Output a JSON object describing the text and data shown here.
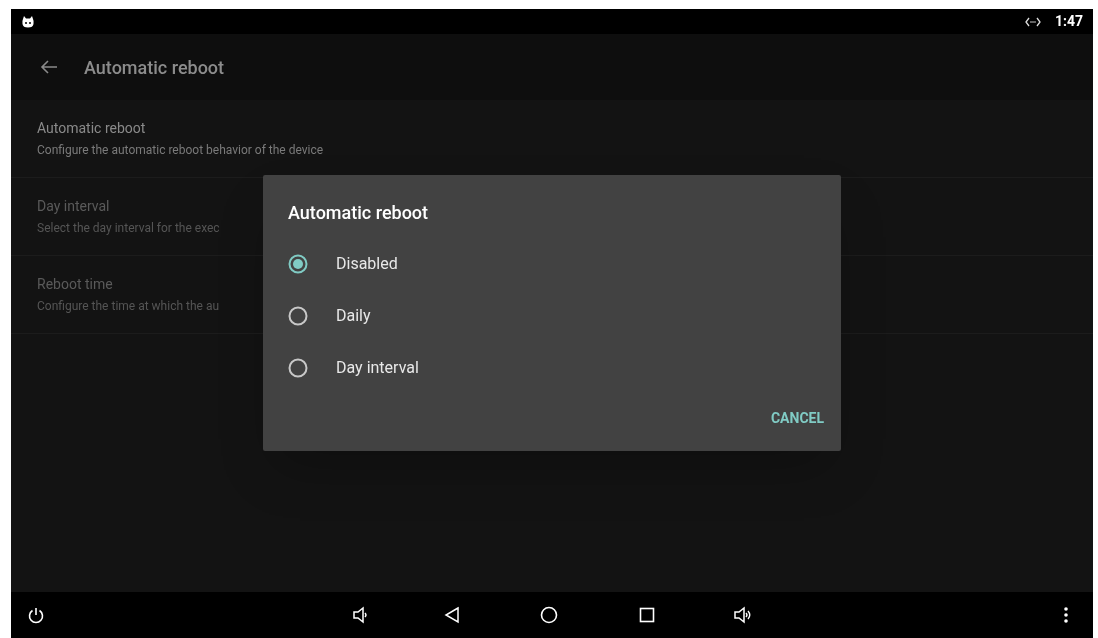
{
  "status_bar": {
    "time": "1:47"
  },
  "toolbar": {
    "title": "Automatic reboot"
  },
  "preferences": [
    {
      "title": "Automatic reboot",
      "summary": "Configure the automatic reboot behavior of the device",
      "enabled": true
    },
    {
      "title": "Day interval",
      "summary": "Select the day interval for the exec",
      "enabled": false
    },
    {
      "title": "Reboot time",
      "summary": "Configure the time at which the au",
      "enabled": false
    }
  ],
  "dialog": {
    "title": "Automatic reboot",
    "options": [
      {
        "label": "Disabled",
        "selected": true
      },
      {
        "label": "Daily",
        "selected": false
      },
      {
        "label": "Day interval",
        "selected": false
      }
    ],
    "buttons": [
      "CANCEL"
    ]
  }
}
